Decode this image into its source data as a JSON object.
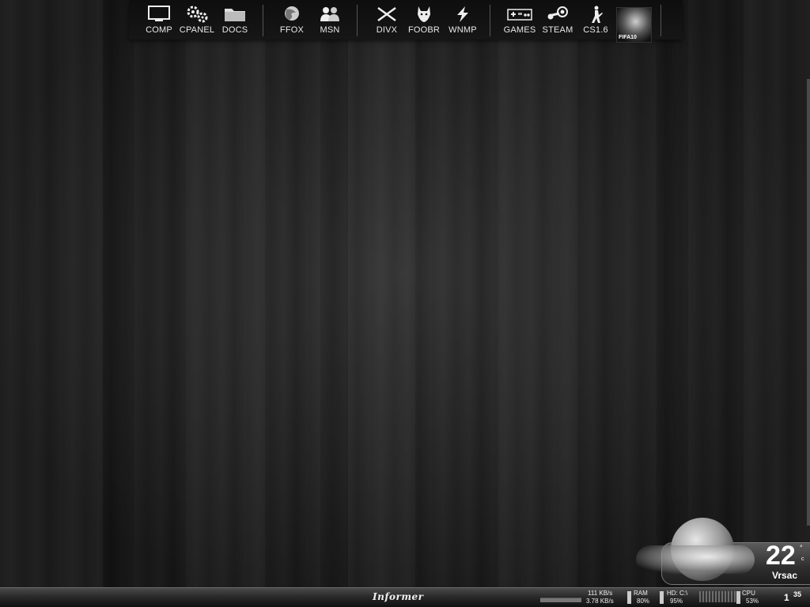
{
  "dock": {
    "items": [
      {
        "label": "COMP",
        "icon": "monitor-icon"
      },
      {
        "label": "CPANEL",
        "icon": "gears-icon"
      },
      {
        "label": "DOCS",
        "icon": "folder-icon"
      },
      {
        "label": "FFOX",
        "icon": "firefox-icon"
      },
      {
        "label": "MSN",
        "icon": "msn-buddies-icon"
      },
      {
        "label": "DIVX",
        "icon": "divx-icon"
      },
      {
        "label": "FOOBR",
        "icon": "foobar-fox-icon"
      },
      {
        "label": "WNMP",
        "icon": "winamp-bolt-icon"
      },
      {
        "label": "GAMES",
        "icon": "gamepad-icon"
      },
      {
        "label": "STEAM",
        "icon": "steam-icon"
      },
      {
        "label": "CS1.6",
        "icon": "counter-strike-icon"
      }
    ],
    "fifa_label": "FIFA10"
  },
  "weather": {
    "temperature": "22",
    "degree": "°",
    "unit": "c",
    "city": "Vrsac",
    "icon": "moon-cloud-icon"
  },
  "informer": {
    "brand": "Informer",
    "net_down": "111 KB/s",
    "net_up": "3.78 KB/s",
    "ram_label": "RAM",
    "ram_value": "80%",
    "hd_label": "HD: C:\\",
    "hd_value": "95%",
    "cpu_label": "CPU",
    "cpu_value": "53%",
    "clock_hour": "1",
    "clock_min": "35"
  }
}
